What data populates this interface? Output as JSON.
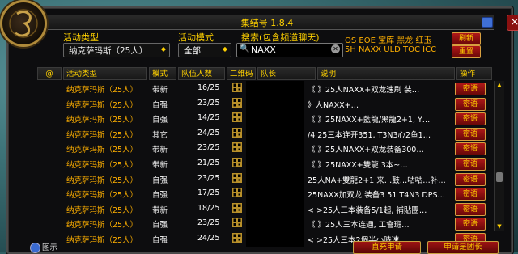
{
  "window": {
    "title": "集结号 1.8.4"
  },
  "filters": {
    "activity_type_label": "活动类型",
    "activity_type_value": "纳克萨玛斯（25人）",
    "mode_label": "活动模式",
    "mode_value": "全部",
    "search_label": "搜索(包含频道聊天)",
    "search_value": "NAXX"
  },
  "quick_tags": {
    "line1": "OS EOE 宝库 黑龙 红玉",
    "line2": "5H NAXX ULD TOC ICC"
  },
  "buttons": {
    "refresh": "刷新",
    "reset": "重置"
  },
  "columns": {
    "at": "@",
    "activity": "活动类型",
    "mode": "模式",
    "size": "队伍人数",
    "qr": "二维码",
    "leader": "队长",
    "desc": "说明",
    "ops": "操作"
  },
  "rows": [
    {
      "activity": "纳克萨玛斯（25人）",
      "mode": "带新",
      "size": "16/25",
      "desc": "《  》25人NAXX+双龙速刷 装…",
      "action": "密语"
    },
    {
      "activity": "纳克萨玛斯（25人）",
      "mode": "自强",
      "size": "23/25",
      "desc": "      》人NAXX+…",
      "action": "密语"
    },
    {
      "activity": "纳克萨玛斯（25人）",
      "mode": "自强",
      "size": "14/25",
      "desc": "《  》25NAXX+藍龍/黑龍2+1, Y…",
      "action": "密语"
    },
    {
      "activity": "纳克萨玛斯（25人）",
      "mode": "其它",
      "size": "24/25",
      "desc": "/4 25三本连开351, T3N3心2鱼1…",
      "action": "密语"
    },
    {
      "activity": "纳克萨玛斯（25人）",
      "mode": "带新",
      "size": "23/25",
      "desc": "《  》25人NAXX+双龙装备300…",
      "action": "密语"
    },
    {
      "activity": "纳克萨玛斯（25人）",
      "mode": "带新",
      "size": "21/25",
      "desc": "《  》25NAXX+雙龍 3本~…",
      "action": "密语"
    },
    {
      "activity": "纳克萨玛斯（25人）",
      "mode": "自强",
      "size": "23/25",
      "desc": "25人NA+雙龍2+1 来…鼓…咕咕…补…",
      "action": "密语"
    },
    {
      "activity": "纳克萨玛斯（25人）",
      "mode": "自强",
      "size": "17/25",
      "desc": "25NAXX加双龙 装备3 51 T4N3 DPS…",
      "action": "密语"
    },
    {
      "activity": "纳克萨玛斯（25人）",
      "mode": "带新",
      "size": "18/25",
      "desc": "<  >25人三本装备5/1起, 補貼團…",
      "action": "密语"
    },
    {
      "activity": "纳克萨玛斯（25人）",
      "mode": "自强",
      "size": "23/25",
      "desc": "《  》25人三本连通, 工會班…",
      "action": "密语"
    },
    {
      "activity": "纳克萨玛斯（25人）",
      "mode": "自强",
      "size": "24/25",
      "desc": "<  >25人三本2個半小時速…",
      "action": "密语"
    }
  ],
  "footer": {
    "legend": "图示",
    "direct_apply": "直充申请",
    "apply_group": "申请是团长"
  },
  "colors": {
    "gold": "#ffd100",
    "orange": "#ffb000",
    "red_button": "#b01818"
  }
}
